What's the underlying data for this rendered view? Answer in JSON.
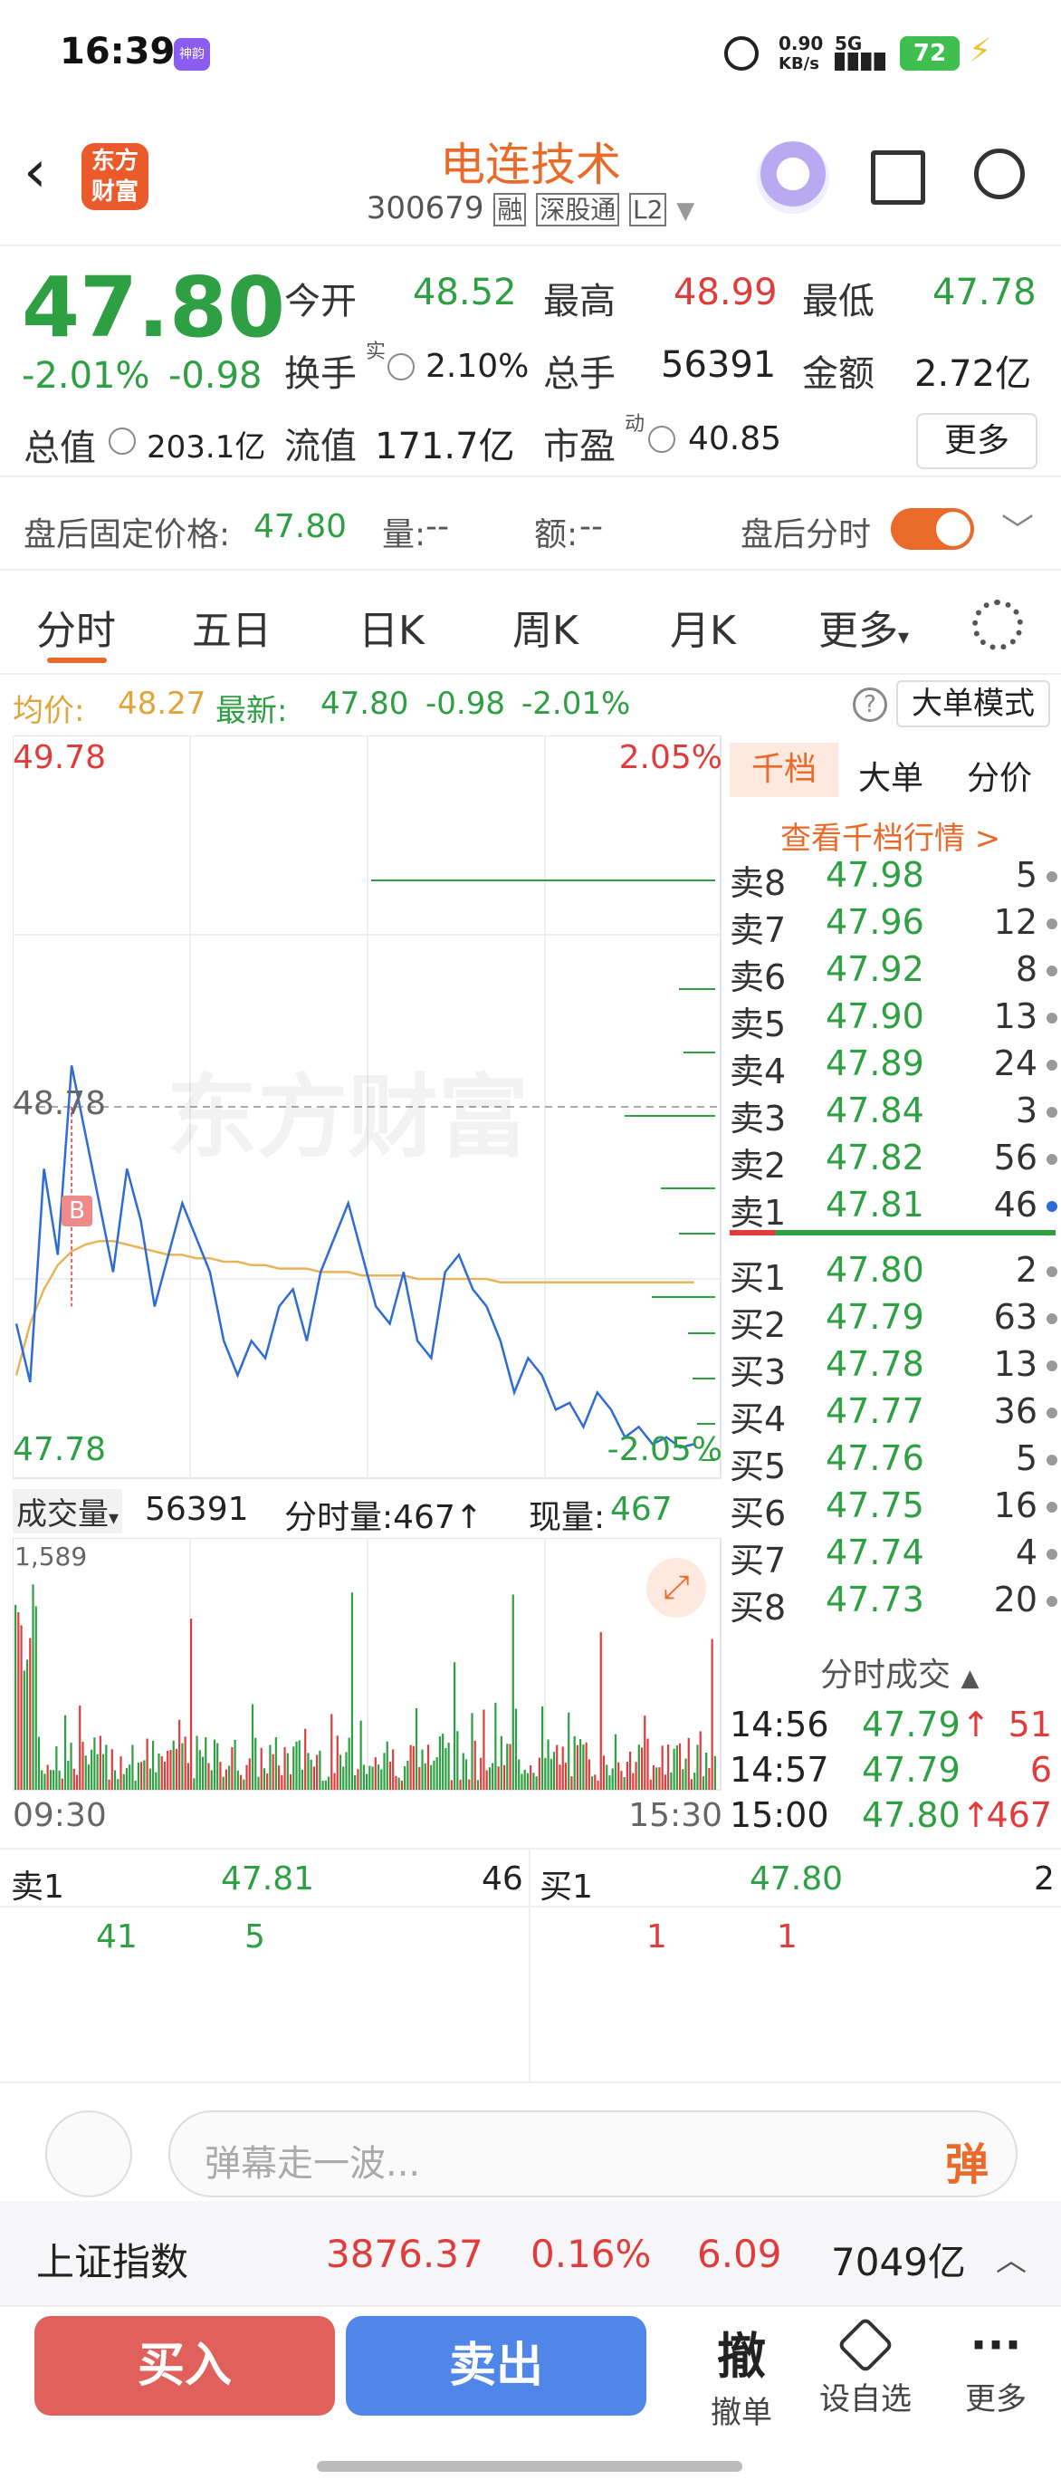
{
  "status": {
    "time": "16:39",
    "app_badge": "神韵",
    "net_speed_top": "0.90",
    "net_speed_unit": "KB/s",
    "net_type": "5G",
    "battery": "72"
  },
  "header": {
    "logo_line1": "东方",
    "logo_line2": "财富",
    "stock_name": "电连技术",
    "stock_code": "300679",
    "badges": [
      "融",
      "深股通",
      "L2"
    ]
  },
  "quote": {
    "price": "47.80",
    "change_pct": "-2.01%",
    "change_abs": "-0.98",
    "open_label": "今开",
    "open": "48.52",
    "high_label": "最高",
    "high": "48.99",
    "low_label": "最低",
    "low": "47.78",
    "turnover_label": "换手",
    "turnover_sup": "实",
    "turnover": "2.10%",
    "volume_label": "总手",
    "volume": "56391",
    "amount_label": "金额",
    "amount": "2.72亿",
    "mktcap_label": "总值",
    "mktcap": "203.1亿",
    "float_label": "流值",
    "float": "171.7亿",
    "pe_label": "市盈",
    "pe_sup": "动",
    "pe": "40.85",
    "more_button": "更多"
  },
  "after_hours": {
    "label": "盘后固定价格:",
    "price": "47.80",
    "vol_label": "量:",
    "vol": "--",
    "amt_label": "额:",
    "amt": "--",
    "toggle_label": "盘后分时"
  },
  "tabs": [
    "分时",
    "五日",
    "日K",
    "周K",
    "月K",
    "更多"
  ],
  "info_line": {
    "avg_label": "均价:",
    "avg": "48.27",
    "latest_label": "最新:",
    "latest": "47.80",
    "chg": "-0.98",
    "pct": "-2.01%",
    "mode_button": "大单模式"
  },
  "chart": {
    "y_high": "49.78",
    "y_mid": "48.78",
    "y_low": "47.78",
    "pct_high": "2.05%",
    "pct_low": "-2.05%",
    "watermark": "东方财富",
    "marker": "B",
    "price_points": [
      48.15,
      47.98,
      48.6,
      48.35,
      48.9,
      48.7,
      48.5,
      48.3,
      48.6,
      48.45,
      48.2,
      48.35,
      48.5,
      48.4,
      48.3,
      48.1,
      48.0,
      48.1,
      48.05,
      48.2,
      48.25,
      48.1,
      48.3,
      48.4,
      48.5,
      48.35,
      48.2,
      48.15,
      48.3,
      48.1,
      48.05,
      48.3,
      48.35,
      48.25,
      48.2,
      48.1,
      47.95,
      48.05,
      48.0,
      47.9,
      47.92,
      47.85,
      47.95,
      47.9,
      47.82,
      47.85,
      47.8,
      47.82,
      47.79,
      47.8
    ],
    "avg_points": [
      48.0,
      48.15,
      48.25,
      48.32,
      48.36,
      48.38,
      48.39,
      48.39,
      48.38,
      48.37,
      48.36,
      48.35,
      48.35,
      48.34,
      48.34,
      48.33,
      48.33,
      48.32,
      48.32,
      48.31,
      48.31,
      48.31,
      48.3,
      48.3,
      48.3,
      48.29,
      48.29,
      48.29,
      48.29,
      48.28,
      48.28,
      48.28,
      48.28,
      48.28,
      48.28,
      48.27,
      48.27,
      48.27,
      48.27,
      48.27,
      48.27,
      48.27,
      48.27,
      48.27,
      48.27,
      48.27,
      48.27,
      48.27,
      48.27,
      48.27
    ]
  },
  "orderbook": {
    "tabs": [
      "千档",
      "大单",
      "分价"
    ],
    "link": "查看千档行情 >",
    "asks": [
      {
        "k": "卖8",
        "p": "47.98",
        "q": "5"
      },
      {
        "k": "卖7",
        "p": "47.96",
        "q": "12"
      },
      {
        "k": "卖6",
        "p": "47.92",
        "q": "8"
      },
      {
        "k": "卖5",
        "p": "47.90",
        "q": "13"
      },
      {
        "k": "卖4",
        "p": "47.89",
        "q": "24"
      },
      {
        "k": "卖3",
        "p": "47.84",
        "q": "3"
      },
      {
        "k": "卖2",
        "p": "47.82",
        "q": "56"
      },
      {
        "k": "卖1",
        "p": "47.81",
        "q": "46"
      }
    ],
    "bids": [
      {
        "k": "买1",
        "p": "47.80",
        "q": "2"
      },
      {
        "k": "买2",
        "p": "47.79",
        "q": "63"
      },
      {
        "k": "买3",
        "p": "47.78",
        "q": "13"
      },
      {
        "k": "买4",
        "p": "47.77",
        "q": "36"
      },
      {
        "k": "买5",
        "p": "47.76",
        "q": "5"
      },
      {
        "k": "买6",
        "p": "47.75",
        "q": "16"
      },
      {
        "k": "买7",
        "p": "47.74",
        "q": "4"
      },
      {
        "k": "买8",
        "p": "47.73",
        "q": "20"
      }
    ],
    "trades_title": "分时成交",
    "trades": [
      {
        "t": "14:56",
        "p": "47.79",
        "arrow": "↑",
        "q": "51"
      },
      {
        "t": "14:57",
        "p": "47.79",
        "arrow": "",
        "q": "6"
      },
      {
        "t": "15:00",
        "p": "47.80",
        "arrow": "↑",
        "q": "467"
      }
    ]
  },
  "volume": {
    "label": "成交量",
    "total": "56391",
    "tick_label": "分时量:467↑",
    "now_label": "现量:",
    "now": "467",
    "max": "1,589",
    "time_start": "09:30",
    "time_end": "15:30"
  },
  "bidask": {
    "sell_label": "卖1",
    "sell_price": "47.81",
    "sell_qty": "46",
    "sell_split": [
      "41",
      "5"
    ],
    "buy_label": "买1",
    "buy_price": "47.80",
    "buy_qty": "2",
    "buy_split": [
      "1",
      "1"
    ]
  },
  "danmu": {
    "placeholder": "弹幕走一波...",
    "send_label": "弹"
  },
  "index": {
    "name": "上证指数",
    "value": "3876.37",
    "pct": "0.16%",
    "chg": "6.09",
    "amount": "7049亿"
  },
  "actions": {
    "buy": "买入",
    "sell": "卖出",
    "cancel_icon": "撤",
    "cancel": "撤单",
    "watch": "设自选",
    "more": "更多"
  },
  "colors": {
    "red": "#e03c3c",
    "green": "#2ea043",
    "orange": "#ea6a2a",
    "blue": "#2f6bd6",
    "avg_line": "#e9b35a"
  }
}
